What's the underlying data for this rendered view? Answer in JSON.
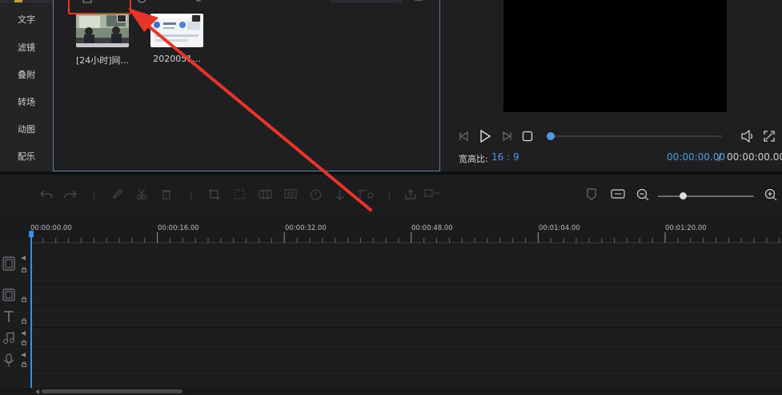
{
  "sidebar": {
    "items": [
      {
        "label": "文字"
      },
      {
        "label": "滤镜"
      },
      {
        "label": "叠附"
      },
      {
        "label": "转场"
      },
      {
        "label": "动图"
      },
      {
        "label": "配乐"
      }
    ]
  },
  "media": {
    "items": [
      {
        "label": "[24小时]网...",
        "thumb": "news-studio"
      },
      {
        "label": "2020051...",
        "thumb": "web-page"
      }
    ]
  },
  "preview": {
    "ratio_label": "宽高比:",
    "ratio_value": "16 : 9",
    "time_current": "00:00:00.00",
    "time_separator": "/",
    "time_total": "00:00:00.00",
    "seek_progress": 0
  },
  "timeline": {
    "ruler_labels": [
      "00:00:00.00",
      "00:00:16.00",
      "00:00:32.00",
      "00:00:48.00",
      "00:01:04.00",
      "00:01:20.00"
    ],
    "zoom_level": 0.25,
    "tracks": [
      {
        "icon": "video-track-icon"
      },
      {
        "icon": "overlay-track-icon"
      },
      {
        "icon": "text-track-icon"
      },
      {
        "icon": "music-track-icon"
      },
      {
        "icon": "voice-track-icon"
      }
    ]
  },
  "colors": {
    "accent": "#4e9be6",
    "annotation": "#e8352b",
    "panel_border": "#5a7fa8"
  }
}
